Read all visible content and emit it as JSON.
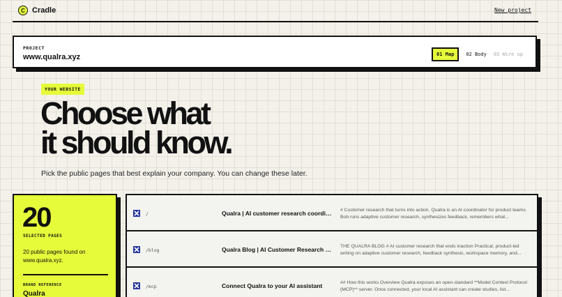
{
  "topbar": {
    "logo_letter": "C",
    "brand": "Cradle",
    "new_project_label": "New project"
  },
  "project": {
    "label": "PROJECT",
    "url": "www.qualra.xyz",
    "steps": [
      {
        "label": "01 Map",
        "state": "active"
      },
      {
        "label": "02 Body",
        "state": "normal"
      },
      {
        "label": "03 Wire up",
        "state": "disabled"
      }
    ]
  },
  "hero": {
    "badge": "YOUR WEBSITE",
    "headline_line1": "Choose what",
    "headline_line2": "it should know.",
    "subtext": "Pick the public pages that best explain your company. You can change these later."
  },
  "summary": {
    "count": "20",
    "count_label": "SELECTED PAGES",
    "description": "20 public pages found on www.qualra.xyz.",
    "brand_ref_label": "BRAND REFERENCE",
    "brand_ref_value": "Qualra"
  },
  "pages": [
    {
      "checked": true,
      "path": "/",
      "title": "Qualra | AI customer research coordinator",
      "description": "# Customer research that turns into action. Qualra is an AI coordinator for product teams. Bob runs adaptive customer research, synthesizes feedback, remembers what..."
    },
    {
      "checked": true,
      "path": "/blog",
      "title": "Qualra Blog | AI Customer Research & Feedback",
      "description": "THE QUALRA BLOG # AI customer research that ends inaction Practical, product-led writing on adaptive customer research, feedback synthesis, workspace memory, and..."
    },
    {
      "checked": true,
      "path": "/mcp",
      "title": "Connect Qualra to your AI assistant",
      "description": "## How this works Overview Qualra exposes an open-standard **Model Context Protocol (MCP)** server. Once connected, your local AI assistant can create studies, list..."
    }
  ],
  "colors": {
    "accent": "#e6fb3a",
    "ink": "#111111",
    "checkbox": "#24349a",
    "background": "#f3f1ea"
  }
}
